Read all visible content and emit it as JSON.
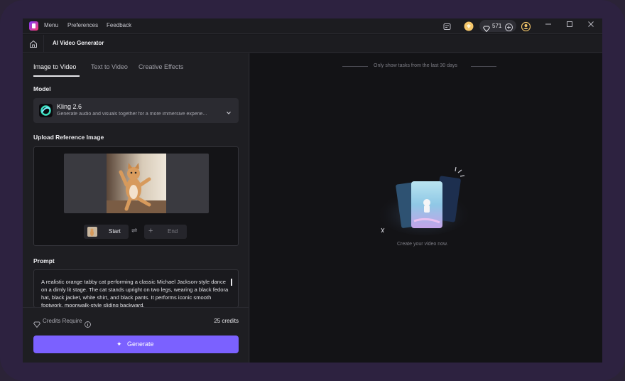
{
  "titlebar": {
    "menu": [
      "Menu",
      "Preferences",
      "Feedback"
    ],
    "credits_count": "571",
    "icons": [
      "app-logo-icon",
      "notes-icon",
      "coin-icon",
      "diamond-icon",
      "plus-icon",
      "user-badge-icon"
    ],
    "window_controls": [
      "minimize",
      "maximize",
      "close"
    ]
  },
  "nav": {
    "page_title": "AI Video Generator"
  },
  "left": {
    "tabs": [
      {
        "label": "Image to Video",
        "active": true
      },
      {
        "label": "Text to Video",
        "active": false
      },
      {
        "label": "Creative Effects",
        "active": false
      }
    ],
    "model_label": "Model",
    "model": {
      "name": "Kling 2.6",
      "description": "Generate audio and visuals together for a more immersive experie..."
    },
    "upload_label": "Upload Reference Image",
    "start_label": "Start",
    "end_label": "End",
    "prompt_label": "Prompt",
    "prompt_text": "A realistic orange tabby cat performing a classic Michael Jackson-style dance on a dimly lit stage. The cat stands upright on two legs, wearing a black fedora hat, black jacket, white shirt, and black pants. It performs iconic smooth footwork, moonwalk-style sliding backward,",
    "credits_label": "Credits Require",
    "credits_value": "25 credits",
    "generate_label": "Generate"
  },
  "right": {
    "notice": "Only show tasks from the last 30 days",
    "empty_text": "Create your video now."
  },
  "colors": {
    "accent": "#7b61ff",
    "background": "#19191d",
    "frame": "#2d2240"
  }
}
